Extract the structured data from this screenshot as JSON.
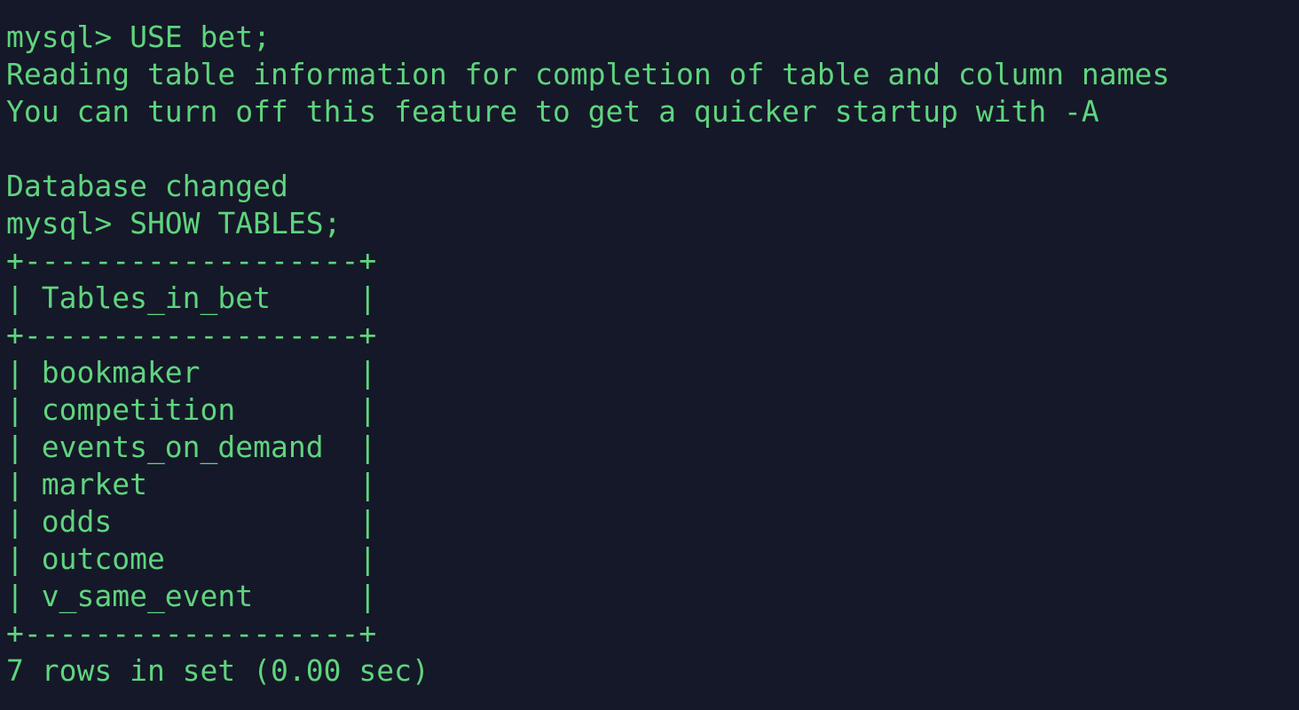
{
  "terminal": {
    "lines": [
      "mysql> USE bet;",
      "Reading table information for completion of table and column names",
      "You can turn off this feature to get a quicker startup with -A",
      "",
      "Database changed",
      "mysql> SHOW TABLES;",
      "+-------------------+",
      "| Tables_in_bet     |",
      "+-------------------+",
      "| bookmaker         |",
      "| competition       |",
      "| events_on_demand  |",
      "| market            |",
      "| odds              |",
      "| outcome           |",
      "| v_same_event      |",
      "+-------------------+",
      "7 rows in set (0.00 sec)"
    ]
  },
  "colors": {
    "background": "#151828",
    "text": "#5fd47e"
  }
}
